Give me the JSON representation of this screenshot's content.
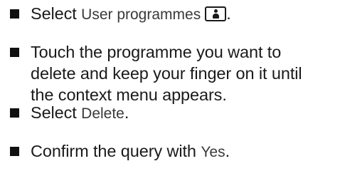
{
  "steps": [
    {
      "verb": "Select",
      "ui_term": "User programmes",
      "icon": "user-icon",
      "end": "."
    },
    {
      "text_line1": "Touch the programme you want to",
      "text_line2": "delete and keep your finger on it until",
      "text_line3": "the context menu appears."
    },
    {
      "verb": "Select",
      "ui_term": "Delete",
      "end": "."
    },
    {
      "text": "Confirm the query with",
      "ui_term": "Yes",
      "end": "."
    }
  ]
}
